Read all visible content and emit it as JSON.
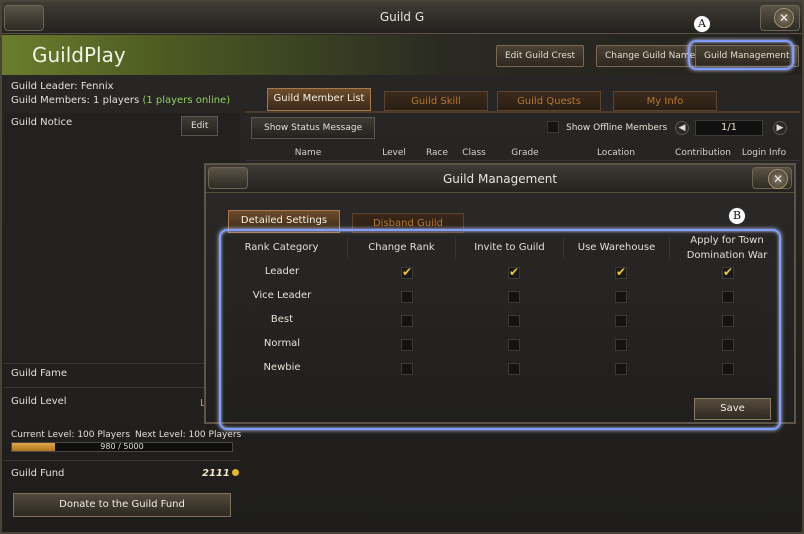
{
  "window": {
    "title": "Guild G",
    "close_icon": "close-icon"
  },
  "banner": {
    "guild_name": "GuildPlay",
    "buttons": [
      "Edit Guild Crest",
      "Change Guild Name",
      "Guild Management"
    ]
  },
  "guild_info": {
    "leader": "Guild Leader: Fennix",
    "members": "Guild Members: 1 players",
    "online": "(1 players online)",
    "notice_label": "Guild Notice",
    "notice_edit": "Edit",
    "fame_label": "Guild Fame",
    "level_label": "Guild Level",
    "level_value": "L",
    "current_level": "Current Level: 100 Players",
    "next_level": "Next Level: 100 Players",
    "progress_text": "980 / 5000",
    "progress": 0.196,
    "fund_label": "Guild Fund",
    "fund_value": "2111",
    "donate_label": "Donate to the Guild Fund"
  },
  "main_tabs": [
    "Guild Member List",
    "Guild Skill",
    "Guild Quests",
    "My Info"
  ],
  "member_list": {
    "status_button": "Show Status Message",
    "offline_label": "Show Offline Members",
    "page": "1/1",
    "columns": [
      "Name",
      "Level",
      "Race",
      "Class",
      "Grade",
      "Location",
      "Contribution",
      "Login Info"
    ]
  },
  "modal": {
    "title": "Guild Management",
    "tabs": [
      "Detailed Settings",
      "Disband Guild"
    ],
    "columns": [
      "Rank Category",
      "Change Rank",
      "Invite to Guild",
      "Use Warehouse",
      "Apply for Town",
      "Domination War"
    ],
    "ranks": [
      {
        "name": "Leader",
        "perms": [
          true,
          true,
          true,
          true
        ]
      },
      {
        "name": "Vice Leader",
        "perms": [
          false,
          false,
          false,
          false
        ]
      },
      {
        "name": "Best",
        "perms": [
          false,
          false,
          false,
          false
        ]
      },
      {
        "name": "Normal",
        "perms": [
          false,
          false,
          false,
          false
        ]
      },
      {
        "name": "Newbie",
        "perms": [
          false,
          false,
          false,
          false
        ]
      }
    ],
    "save_label": "Save"
  },
  "callouts": {
    "a": "A",
    "b": "B"
  }
}
